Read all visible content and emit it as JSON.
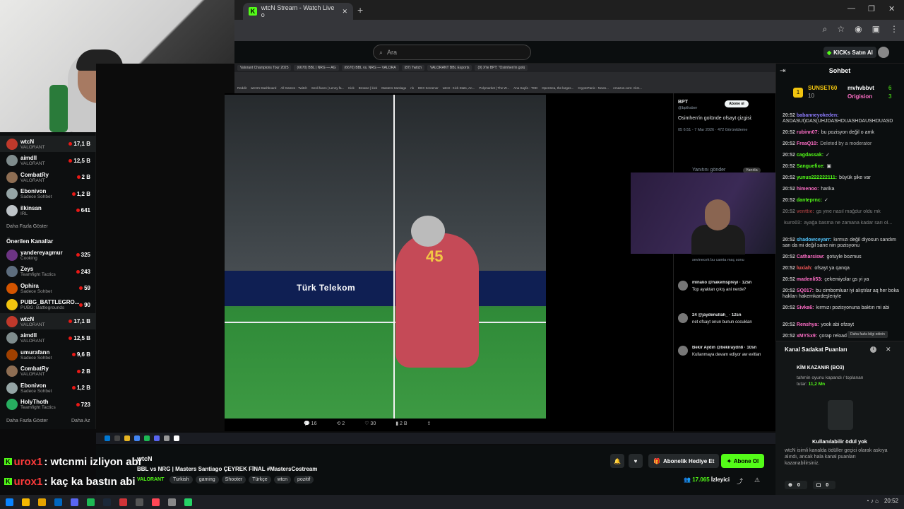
{
  "browser": {
    "tab_title": "wtcN Stream - Watch Live o",
    "new_tab": "+",
    "window_controls": [
      "—",
      "❐",
      "✕"
    ]
  },
  "kick": {
    "search_placeholder": "Ara",
    "buy_kicks": "KICKs Satın Al"
  },
  "sidebar": {
    "following": [
      {
        "name": "wtcN",
        "category": "VALORANT",
        "viewers": "17,1 B",
        "color": "#c0392b",
        "active": true
      },
      {
        "name": "aimdll",
        "category": "VALORANT",
        "viewers": "12,5 B",
        "color": "#7f8c8d"
      },
      {
        "name": "CombatRy",
        "category": "VALORANT",
        "viewers": "2 B",
        "color": "#8e6e53"
      },
      {
        "name": "Ebonivon",
        "category": "Sadece Sohbet",
        "viewers": "1,2 B",
        "color": "#95a5a6"
      },
      {
        "name": "ilkinsan",
        "category": "IRL",
        "viewers": "641",
        "color": "#bdc3c7"
      }
    ],
    "show_more": "Daha Fazla Göster",
    "recommended_heading": "Önerilen Kanallar",
    "recommended": [
      {
        "name": "yandereyagmur",
        "category": "Cooking",
        "viewers": "325",
        "color": "#6c3483"
      },
      {
        "name": "Zeys",
        "category": "Teamfight Tactics",
        "viewers": "243",
        "color": "#5d6d7e"
      },
      {
        "name": "Ophira",
        "category": "Sadece Sohbet",
        "viewers": "59",
        "color": "#d35400"
      },
      {
        "name": "PUBG_BATTLEGRO...",
        "category": "PUBG: Battlegrounds",
        "viewers": "90",
        "color": "#f1c40f"
      },
      {
        "name": "wtcN",
        "category": "VALORANT",
        "viewers": "17,1 B",
        "color": "#c0392b",
        "active": true
      },
      {
        "name": "aimdll",
        "category": "VALORANT",
        "viewers": "12,5 B",
        "color": "#7f8c8d"
      },
      {
        "name": "umurafann",
        "category": "Sadece Sohbet",
        "viewers": "9,6 B",
        "color": "#a04000"
      },
      {
        "name": "CombatRy",
        "category": "VALORANT",
        "viewers": "2 B",
        "color": "#8e6e53"
      },
      {
        "name": "Ebonivon",
        "category": "Sadece Sohbet",
        "viewers": "1,2 B",
        "color": "#95a5a6"
      },
      {
        "name": "HolyThoth",
        "category": "Teamfight Tactics",
        "viewers": "723",
        "color": "#27ae60"
      }
    ],
    "show_more2": "Daha Fazla Göster",
    "show_less": "Daha Az"
  },
  "inner_browser": {
    "tabs": [
      "Valorant Champions Tour 2025",
      "(6670) BBL | NRG — AG",
      "(6670) BBL vs. NRG — VALORA",
      "(87) Twitch",
      "VALORANT BBL Esports",
      "(9) X'te BPT: \"Osimhen'in golü"
    ],
    "bookmarks": [
      "Reddit",
      "wtcN's Dashboard",
      "All Games - Twitch",
      "Sesli faces | Lenny fa...",
      "Kick",
      "Browse | kick",
      "Masters Santiago",
      "nlı",
      "DEX Screener",
      "wtcN - Kick Stats, An...",
      "Polymarket | The W...",
      "Ana Sayfa - TOD",
      "OpenSea, the larges...",
      "CryptoPanic - News...",
      "Amazon.com: Alım..."
    ]
  },
  "video": {
    "banner_text": "Türk Telekom",
    "jersey_number": "45",
    "actions": [
      "16",
      "2",
      "30",
      "2 B"
    ]
  },
  "tweet": {
    "author": "BPT",
    "handle": "@bpthaber",
    "subscribe": "Abone ol",
    "text": "Osimhen'in golünde ofsayt çizgisi:",
    "meta": "05 6:51 - 7 Mar 2026 · 472 Görüntüleme",
    "reply_placeholder": "Yanıtını gönder",
    "reply_btn": "Yanıtla",
    "replies": [
      {
        "user": "minako",
        "handle": "@hakemspreyi · 12sn",
        "text": "Top ayaktan çıkış ani nerde?"
      },
      {
        "user": "24",
        "handle": "@jaydenullah_ · 12sn",
        "text": "net ofsayt onun bunun cocuklan"
      },
      {
        "user": "Bekir Aydın",
        "handle": "@bekiraydn8 · 10sn",
        "text": "Kullanmaya devam ediyor aw evitlan"
      }
    ],
    "note": "sevinecek bu camia maç sonu"
  },
  "chat": {
    "title": "Sohbet",
    "pinned_user": "SUNSET60",
    "pinned_count": "10",
    "pinned_items": [
      {
        "name": "mvhvbbvt",
        "count": "6"
      },
      {
        "name": "Origision",
        "count": "3"
      }
    ],
    "messages": [
      {
        "time": "20:52",
        "user": "babanneyokeden",
        "color": "#8e7cff",
        "text": "ASDASUI)DAS(UHJDASHDUASHDAUSHDUASD"
      },
      {
        "time": "20:52",
        "user": "rubinn07",
        "color": "#ff6ec7",
        "text": "bu pozisyon değil o amk"
      },
      {
        "time": "20:52",
        "user": "FreaQ10",
        "color": "#ff6ec7",
        "text": "Deleted by a moderator",
        "deleted": true
      },
      {
        "time": "20:52",
        "user": "cagdassak",
        "color": "#53fc18",
        "text": "✓"
      },
      {
        "time": "20:52",
        "user": "Sanguefixe",
        "color": "#53fc18",
        "text": "▣"
      },
      {
        "time": "20:52",
        "user": "yunus222222111",
        "color": "#53fc18",
        "text": "büyük şike var"
      },
      {
        "time": "20:52",
        "user": "himenoo",
        "color": "#ff6ec7",
        "text": "harika"
      },
      {
        "time": "20:52",
        "user": "danteprnc",
        "color": "#53fc18",
        "text": "✓"
      },
      {
        "time": "20:52",
        "user": "venttie",
        "color": "#ff5a5a",
        "text": "gs yine nasıl mağdur oldu mk",
        "faded": true
      },
      {
        "time": "",
        "user": "kuro03",
        "color": "#aaa",
        "text": "ayağa basma ne zamana kadar sarı ol...",
        "faded": true
      },
      {
        "time": "20:52",
        "user": "shadowceyarr",
        "color": "#53c7ff",
        "text": "kırmızı değil diyosun sandım san da mi değil sane nin pozisyonu"
      },
      {
        "time": "20:52",
        "user": "Catharsisw",
        "color": "#ff6ec7",
        "text": "gotuyle bozmus"
      },
      {
        "time": "20:52",
        "user": "luxiah",
        "color": "#ff5a5a",
        "text": "ofsayt ya qanqa"
      },
      {
        "time": "20:52",
        "user": "madenli53",
        "color": "#ff6ec7",
        "text": "çekemiyolar gs yi ya"
      },
      {
        "time": "20:52",
        "user": "SQ017",
        "color": "#ff6ec7",
        "text": "bu cimbomluar iyi alıştılar aq her boka hakları hakemkardeşleriyle"
      },
      {
        "time": "20:52",
        "user": "Sivka6",
        "color": "#ff6ec7",
        "text": "kırmızı pozisyonuna baktın mi abi"
      },
      {
        "time": "20:52",
        "user": "Renshya",
        "color": "#ff6ec7",
        "text": "yook abi ofzayt"
      },
      {
        "time": "20:52",
        "user": "xMYSx9",
        "color": "#ff6ec7",
        "text": "çorap reload"
      }
    ]
  },
  "loyalty": {
    "title": "Kanal Sadakat Puanları",
    "tooltip": "Daha fazla bilgi edinin",
    "prediction_title": "KİM KAZANIR (BO3)",
    "prediction_text_1": "tahmin oyunu kapandı / toplanan",
    "prediction_text_2": "tutar:",
    "prediction_amount": "11,2 Mn",
    "reward_title": "Kullanılabilir ödül yok",
    "reward_text": "wtcN isimli kanalda ödüller geçici olarak askıya alındı, ancak hala kanal puanları kazanabilirsiniz.",
    "points_a": "0",
    "points_b": "0"
  },
  "overlay": {
    "line1_user": "urox1",
    "line1_text": ": wtcnmi izliyon abi",
    "line2_user": "urox1",
    "line2_text": ": kaç ka bastın abi"
  },
  "stream_info": {
    "streamer": "wtcN",
    "title": "BBL vs NRG | Masters Santiago ÇEYREK FİNAL #MastersCostream",
    "category": "VALORANT",
    "tags": [
      "Turkish",
      "gaming",
      "Shooter",
      "Türkçe",
      "wtcn",
      "pozitif"
    ],
    "gift_label": "Abonelik Hediye Et",
    "follow_label": "Abone Ol",
    "viewers": "17.065",
    "viewers_label": "İzleyici"
  },
  "system": {
    "clock": "20:52"
  }
}
